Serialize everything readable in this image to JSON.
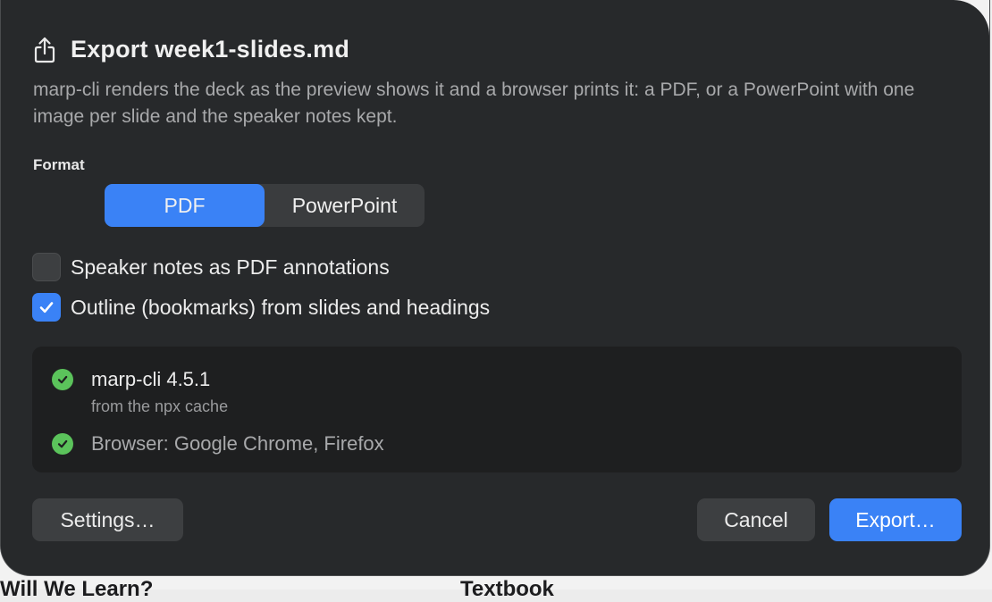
{
  "background": {
    "left_heading": "Will We Learn?",
    "right_heading": "Textbook"
  },
  "dialog": {
    "icon": "share-icon",
    "title": "Export week1-slides.md",
    "description": "marp-cli renders the deck as the preview shows it and a browser prints it: a PDF, or a PowerPoint with one image per slide and the speaker notes kept.",
    "format_label": "Format",
    "format_options": [
      {
        "label": "PDF",
        "selected": true
      },
      {
        "label": "PowerPoint",
        "selected": false
      }
    ],
    "options": [
      {
        "label": "Speaker notes as PDF annotations",
        "checked": false
      },
      {
        "label": "Outline (bookmarks) from slides and headings",
        "checked": true
      }
    ],
    "status": [
      {
        "title": "marp-cli 4.5.1",
        "subtitle": "from the npx cache",
        "icon": "check-circle-icon"
      },
      {
        "title": "Browser: Google Chrome, Firefox",
        "icon": "check-circle-icon"
      }
    ],
    "buttons": {
      "settings": "Settings…",
      "cancel": "Cancel",
      "export": "Export…"
    }
  },
  "colors": {
    "accent": "#3a82f6",
    "success": "#5bc35b",
    "dialog_bg": "#27292b"
  }
}
